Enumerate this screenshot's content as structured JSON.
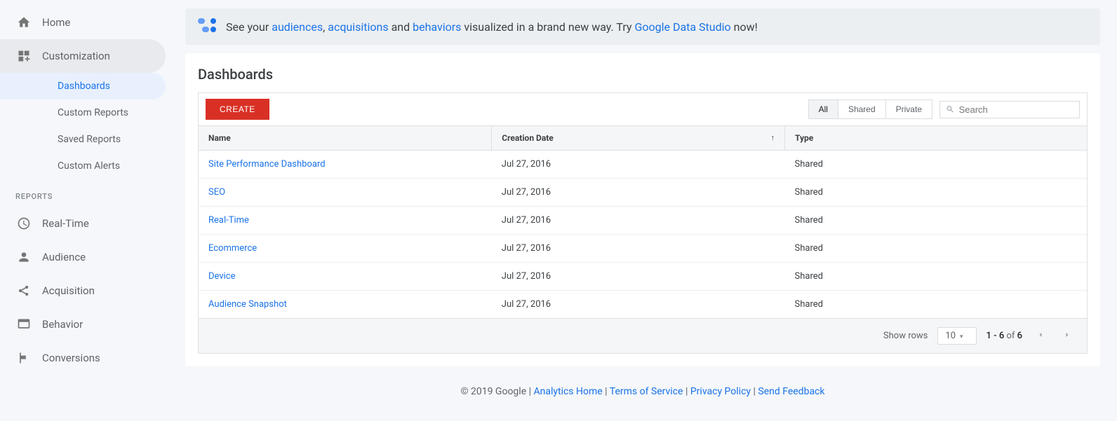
{
  "sidebar": {
    "home": "Home",
    "customization": "Customization",
    "sub": [
      "Dashboards",
      "Custom Reports",
      "Saved Reports",
      "Custom Alerts"
    ],
    "reports_header": "REPORTS",
    "reports": [
      "Real-Time",
      "Audience",
      "Acquisition",
      "Behavior",
      "Conversions"
    ]
  },
  "banner": {
    "pre": "See your ",
    "audiences": "audiences",
    "sep1": ", ",
    "acquisitions": "acquisitions",
    "and": " and ",
    "behaviors": "behaviors",
    "mid": " visualized in a brand new way. Try ",
    "gds": "Google Data Studio",
    "post": " now!"
  },
  "page_title": "Dashboards",
  "create_label": "CREATE",
  "filters": {
    "all": "All",
    "shared": "Shared",
    "private": "Private"
  },
  "search_placeholder": "Search",
  "columns": {
    "name": "Name",
    "creation_date": "Creation Date",
    "type": "Type"
  },
  "rows": [
    {
      "name": "Site Performance Dashboard",
      "date": "Jul 27, 2016",
      "type": "Shared"
    },
    {
      "name": "SEO",
      "date": "Jul 27, 2016",
      "type": "Shared"
    },
    {
      "name": "Real-Time",
      "date": "Jul 27, 2016",
      "type": "Shared"
    },
    {
      "name": "Ecommerce",
      "date": "Jul 27, 2016",
      "type": "Shared"
    },
    {
      "name": "Device",
      "date": "Jul 27, 2016",
      "type": "Shared"
    },
    {
      "name": "Audience Snapshot",
      "date": "Jul 27, 2016",
      "type": "Shared"
    }
  ],
  "pager": {
    "show_rows": "Show rows",
    "rows_value": "10",
    "range": "1 - 6",
    "of": " of ",
    "total": "6"
  },
  "footer": {
    "copyright": "© 2019 Google | ",
    "analytics_home": "Analytics Home",
    "sep": " | ",
    "tos": "Terms of Service",
    "privacy": "Privacy Policy",
    "feedback": "Send Feedback"
  }
}
